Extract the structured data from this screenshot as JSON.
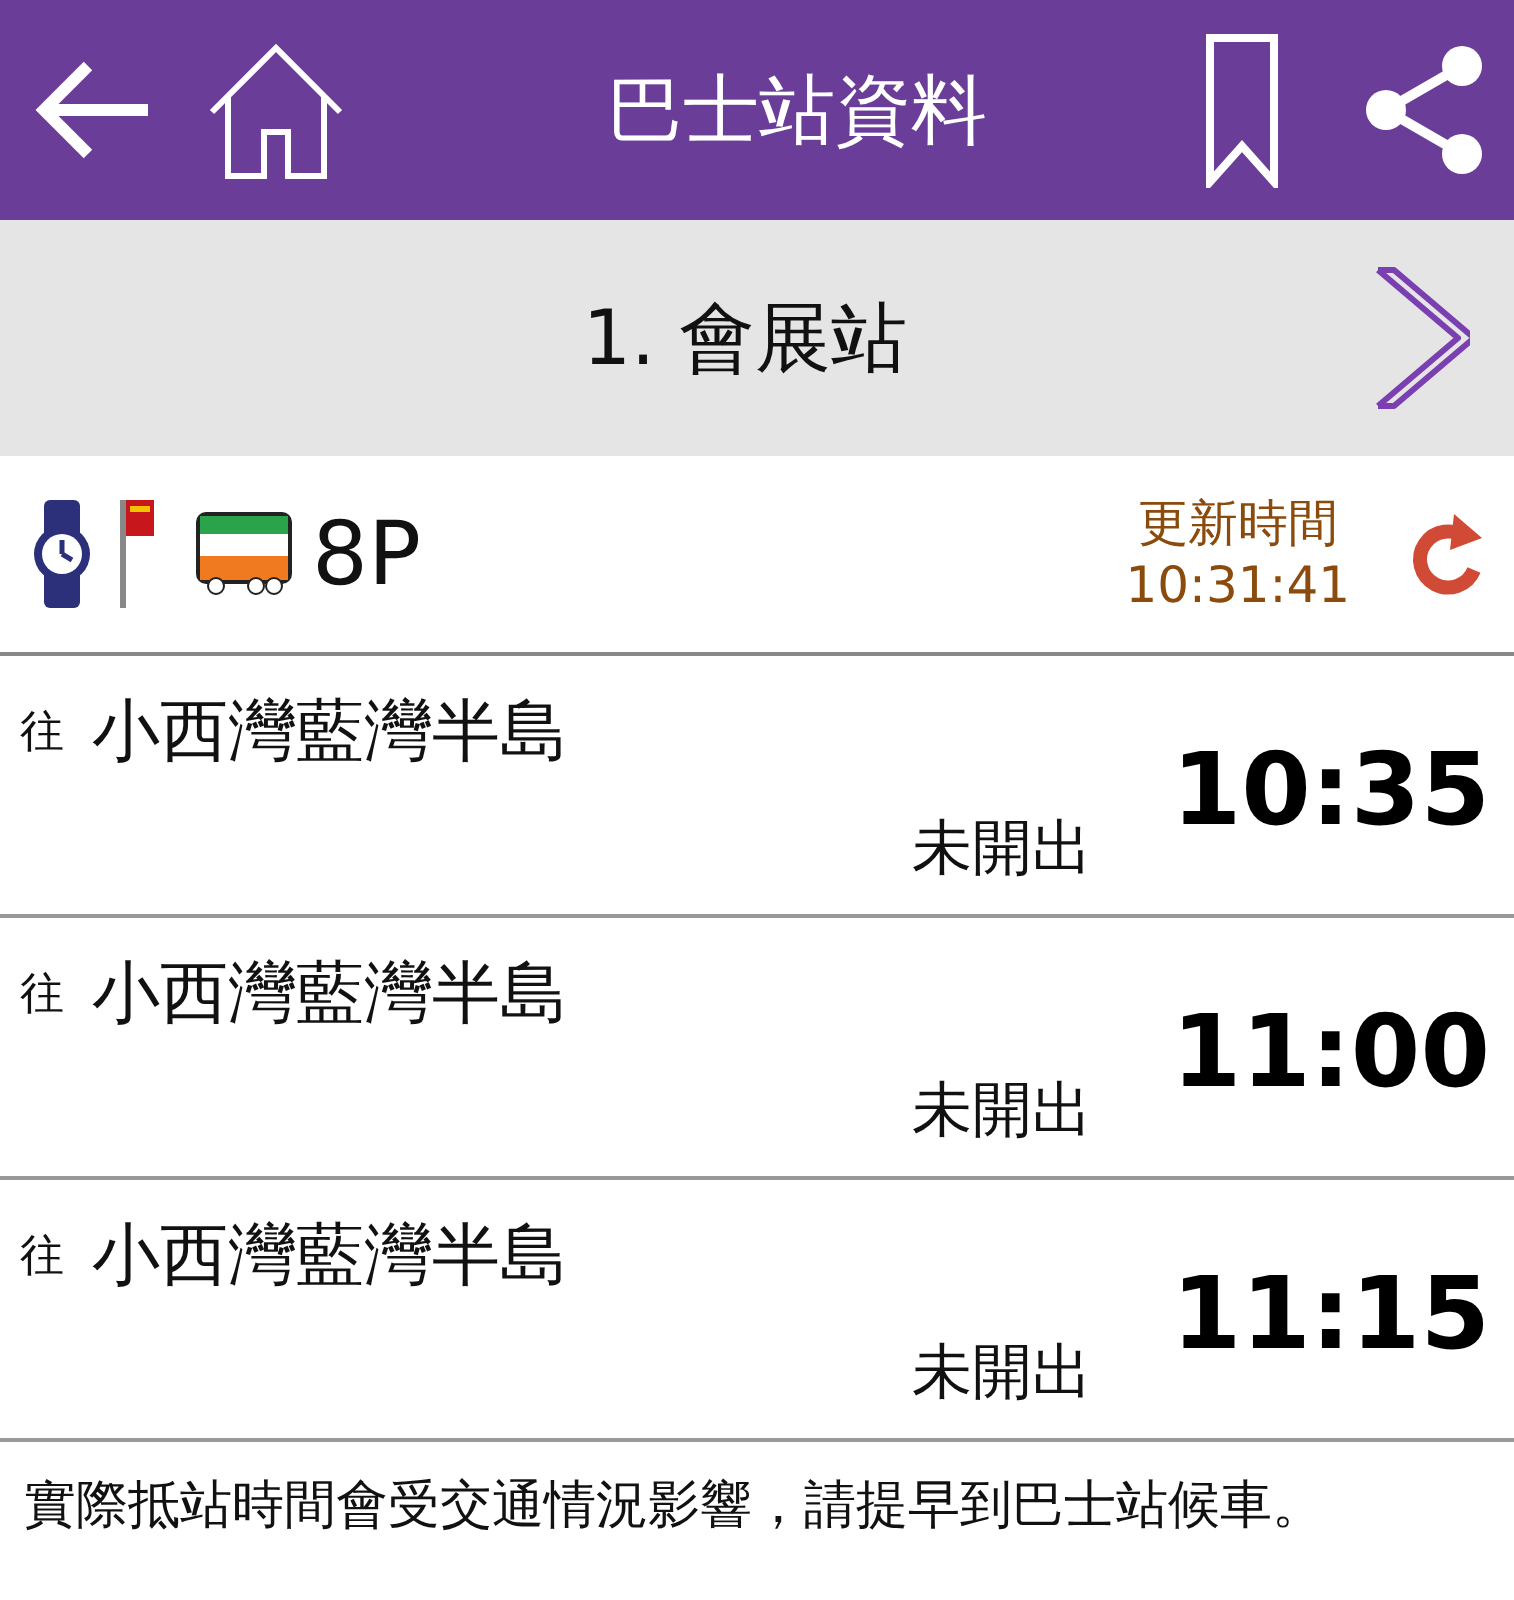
{
  "header": {
    "title": "巴士站資料"
  },
  "station": {
    "name": "1. 會展站"
  },
  "route": {
    "number": "8P",
    "updated_label": "更新時間",
    "updated_time": "10:31:41"
  },
  "departures": [
    {
      "prefix": "往",
      "destination": "小西灣藍灣半島",
      "status": "未開出",
      "time": "10:35"
    },
    {
      "prefix": "往",
      "destination": "小西灣藍灣半島",
      "status": "未開出",
      "time": "11:00"
    },
    {
      "prefix": "往",
      "destination": "小西灣藍灣半島",
      "status": "未開出",
      "time": "11:15"
    }
  ],
  "notice": "實際抵站時間會受交通情況影響，請提早到巴士站候車。"
}
